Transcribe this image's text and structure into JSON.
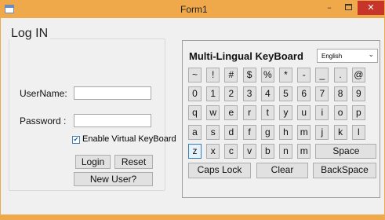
{
  "window": {
    "title": "Form1",
    "minimize_glyph": "–",
    "close_glyph": "✕"
  },
  "login": {
    "group_title": "Log IN",
    "username_label": "UserName:",
    "username_value": "",
    "password_label": "Password :",
    "password_value": "",
    "virtual_keyboard_label": "Enable Virtual KeyBoard",
    "virtual_keyboard_checked": true,
    "login_button": "Login",
    "reset_button": "Reset",
    "new_user_button": "New User?"
  },
  "keyboard": {
    "title": "Multi-Lingual KeyBoard",
    "language_selected": "English",
    "rows": [
      [
        "~",
        "!",
        "#",
        "$",
        "%",
        "*",
        "-",
        "_",
        ".",
        "@"
      ],
      [
        "0",
        "1",
        "2",
        "3",
        "4",
        "5",
        "6",
        "7",
        "8",
        "9"
      ],
      [
        "q",
        "w",
        "e",
        "r",
        "t",
        "y",
        "u",
        "i",
        "o",
        "p"
      ],
      [
        "a",
        "s",
        "d",
        "f",
        "g",
        "h",
        "m",
        "j",
        "k",
        "l"
      ],
      [
        "z",
        "x",
        "c",
        "v",
        "b",
        "n",
        "m",
        "Space"
      ],
      [
        "Caps Lock",
        "Clear",
        "BackSpace"
      ]
    ]
  },
  "icons": {
    "app": "window-app-icon",
    "minimize": "minimize-icon",
    "maximize": "maximize-icon",
    "close": "close-icon",
    "check": "check-icon",
    "dropdown": "chevron-down-icon"
  }
}
